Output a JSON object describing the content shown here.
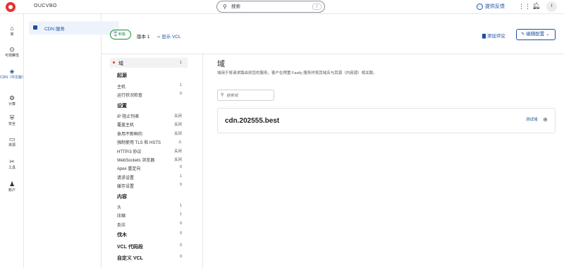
{
  "topbar": {
    "org_name": "OUCVBO",
    "search_placeholder": "搜索",
    "search_shortcut": "/",
    "feedback_label": "提供反馈",
    "avatar_initial": "t"
  },
  "rail": [
    {
      "icon": "home-icon",
      "glyph": "⌂",
      "label": "家"
    },
    {
      "icon": "observability-icon",
      "glyph": "⊙",
      "label": "可观察性"
    },
    {
      "icon": "cdn-icon",
      "glyph": "◈",
      "label": "CDN（中文版）",
      "active": true
    },
    {
      "icon": "compute-icon",
      "glyph": "⚙",
      "label": "计算"
    },
    {
      "icon": "security-icon",
      "glyph": "⛨",
      "label": "安全"
    },
    {
      "icon": "resources-icon",
      "glyph": "▭",
      "label": "资源"
    },
    {
      "icon": "tools-icon",
      "glyph": "✂",
      "label": "工具"
    },
    {
      "icon": "account-icon",
      "glyph": "♟",
      "label": "账户"
    }
  ],
  "subnav": {
    "label": "CDN 服务"
  },
  "header": {
    "status": "积极",
    "version": "版本 1",
    "show_vcl": "显示 VCL",
    "add_comment": "添加评论",
    "edit_config": "编辑配置"
  },
  "sections": {
    "selected": {
      "label": "域",
      "count": "1"
    },
    "origin_title": "起源",
    "origin": [
      {
        "label": "主机",
        "value": "1"
      },
      {
        "label": "运行状况检查",
        "value": "0"
      }
    ],
    "settings_title": "设置",
    "settings": [
      {
        "label": "IP 阻止列表",
        "value": "关闭"
      },
      {
        "label": "覆盖主机",
        "value": "关闭"
      },
      {
        "label": "食用不新鲜的",
        "value": "关闭"
      },
      {
        "label": "强制使用 TLS 和 HSTS",
        "value": "上"
      },
      {
        "label": "HTTP/3 协议",
        "value": "关闭"
      },
      {
        "label": "WebSockets 浏览器",
        "value": "关闭"
      },
      {
        "label": "Apex 重定向",
        "value": "0"
      },
      {
        "label": "请求设置",
        "value": "1"
      },
      {
        "label": "缓存设置",
        "value": "0"
      }
    ],
    "content_title": "内容",
    "content": [
      {
        "label": "头",
        "value": "1"
      },
      {
        "label": "压缩",
        "value": "1"
      },
      {
        "label": "反应",
        "value": "0"
      }
    ],
    "footer": [
      {
        "label": "伐木",
        "value": "0"
      },
      {
        "label": "VCL 代码段",
        "value": "0"
      },
      {
        "label": "自定义 VCL",
        "value": "0"
      }
    ]
  },
  "main": {
    "title": "域",
    "description": "域用于将请求路由到您的服务。客户在预置 Fastly 服务时将其域名与其源（内容源）相关联。",
    "filter_placeholder": "搜索域",
    "domains": [
      {
        "name": "cdn.202555.best",
        "action": "测试域"
      }
    ]
  }
}
